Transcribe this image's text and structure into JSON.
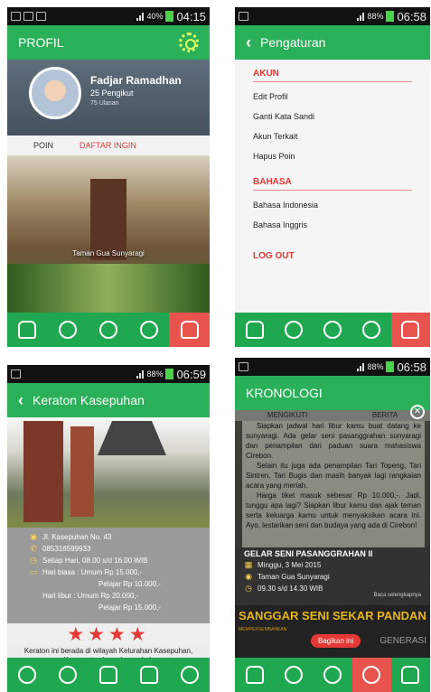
{
  "screen1": {
    "status_time": "04:15",
    "status_battery": "40%",
    "title": "PROFIL",
    "name": "Fadjar Ramadhan",
    "followers": "25 Pengikut",
    "reviews": "75 Ulasan",
    "tabs": [
      "POIN",
      "DAFTAR INGIN"
    ],
    "photo_caption": "Taman Gua Sunyaragi"
  },
  "screen2": {
    "status_time": "06:58",
    "status_battery": "88%",
    "title": "Pengaturan",
    "section_account": "AKUN",
    "account_items": [
      "Edit Profil",
      "Ganti Kata Sandi",
      "Akun Terkait",
      "Hapus Poin"
    ],
    "section_language": "BAHASA",
    "language_items": [
      "Bahasa Indonesia",
      "Bahasa Inggris"
    ],
    "logout": "LOG OUT"
  },
  "screen3": {
    "status_time": "06:59",
    "status_battery": "88%",
    "title": "Keraton Kasepuhan",
    "address": "Jl. Kasepuhan No. 43",
    "phone": "085316599933",
    "hours": "Setiap Hari, 08.00 s/d 16.00 WIB",
    "price_weekday_1": "Hari biasa : Umum Rp 15.000,-",
    "price_weekday_2": "Pelajar Rp 10.000,-",
    "price_holiday_1": "Hari libur   : Umum Rp 20.000,-",
    "price_holiday_2": "Pelajar Rp 15.000,-",
    "rating": 4,
    "description": "Keraton ini berada di wilayah Kelurahan Kasepuhan, Kecamatan Lemahwungkuk"
  },
  "screen4": {
    "status_time": "06:58",
    "status_battery": "88%",
    "title": "KRONOLOGI",
    "tabs": [
      "MENGIKUTI",
      "BERITA"
    ],
    "paragraphs": [
      "Siapkan jadwal hari libur kamu buat datang ke sunyaragi. Ada gelar seni pasanggrahan sunyaragi dan penampilan dari paduan suara mahasiswa Cirebon.",
      "Selain itu juga ada penampilan Tari Topeng, Tari Sintren, Tari Bugis dan masih banyak lagi rangkaian acara yang meriah.",
      "Harga tiket masuk sebesar Rp 10.000,-. Jadi, tunggu apa lagi? Siapkan libur kamu dan ajak teman serta keluarga kamu untuk menyaksikan acara ini. Ayo, lestarikan seni dan budaya yang ada di Cirebon!"
    ],
    "event_title": "GELAR SENI PASANGGRAHAN II",
    "event_date": "Minggu, 3 Mei 2015",
    "event_place": "Taman Gua Sunyaragi",
    "event_time": "09.30 s/d 14.30 WIB",
    "event_more": "Baca selengkapnya",
    "banner_title": "SANGGAR SENI SEKAR PANDAN",
    "banner_sub": "MEMPERSEMBAHKAN",
    "banner_right": "GENERASI",
    "share_label": "Bagikan ini"
  },
  "colors": {
    "green": "#2bb05a",
    "red": "#e53935",
    "nav_active": "#e8534d"
  }
}
